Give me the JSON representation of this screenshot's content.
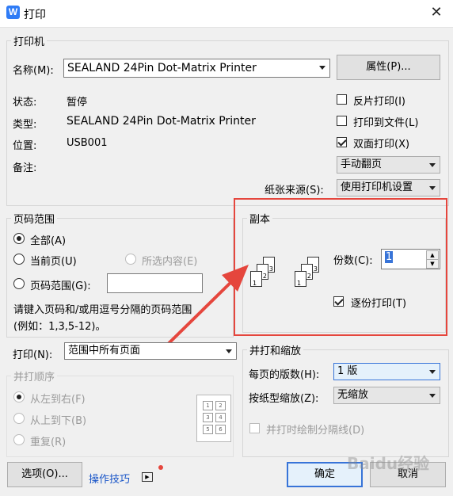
{
  "window": {
    "title": "打印",
    "app_icon_letter": "W"
  },
  "printer": {
    "group_label": "打印机",
    "name_label": "名称(M):",
    "name_value": "SEALAND 24Pin Dot-Matrix Printer",
    "properties_button": "属性(P)...",
    "status_label": "状态:",
    "status_value": "暂停",
    "type_label": "类型:",
    "type_value": "SEALAND 24Pin Dot-Matrix Printer",
    "location_label": "位置:",
    "location_value": "USB001",
    "comment_label": "备注:",
    "reverse_print": "反片打印(I)",
    "print_to_file": "打印到文件(L)",
    "duplex_print": "双面打印(X)",
    "duplex_mode": "手动翻页",
    "paper_source_label": "纸张来源(S):",
    "paper_source_value": "使用打印机设置"
  },
  "page_range": {
    "group_label": "页码范围",
    "all": "全部(A)",
    "current": "当前页(U)",
    "selection": "所选内容(E)",
    "pages": "页码范围(G):",
    "hint_line1": "请键入页码和/或用逗号分隔的页码范围",
    "hint_line2": "(例如：1,3,5-12)。"
  },
  "copies": {
    "group_label": "副本",
    "count_label": "份数(C):",
    "count_value": "1",
    "collate": "逐份打印(T)"
  },
  "print_what": {
    "label": "打印(N):",
    "value": "范围中所有页面"
  },
  "order": {
    "group_label": "并打顺序",
    "ltr": "从左到右(F)",
    "ttb": "从上到下(B)",
    "repeat": "重复(R)"
  },
  "zoom": {
    "group_label": "并打和缩放",
    "pages_per_sheet_label": "每页的版数(H):",
    "pages_per_sheet_value": "1 版",
    "scale_label": "按纸型缩放(Z):",
    "scale_value": "无缩放",
    "draw_borders": "并打时绘制分隔线(D)"
  },
  "footer": {
    "options_button": "选项(O)...",
    "tips_link": "操作技巧",
    "ok_button": "确定",
    "cancel_button": "取消"
  },
  "watermark": "Baidu经验",
  "colors": {
    "annotation_red": "#e5463d",
    "app_blue": "#2f7cf6",
    "tips_blue": "#1a56c8"
  }
}
